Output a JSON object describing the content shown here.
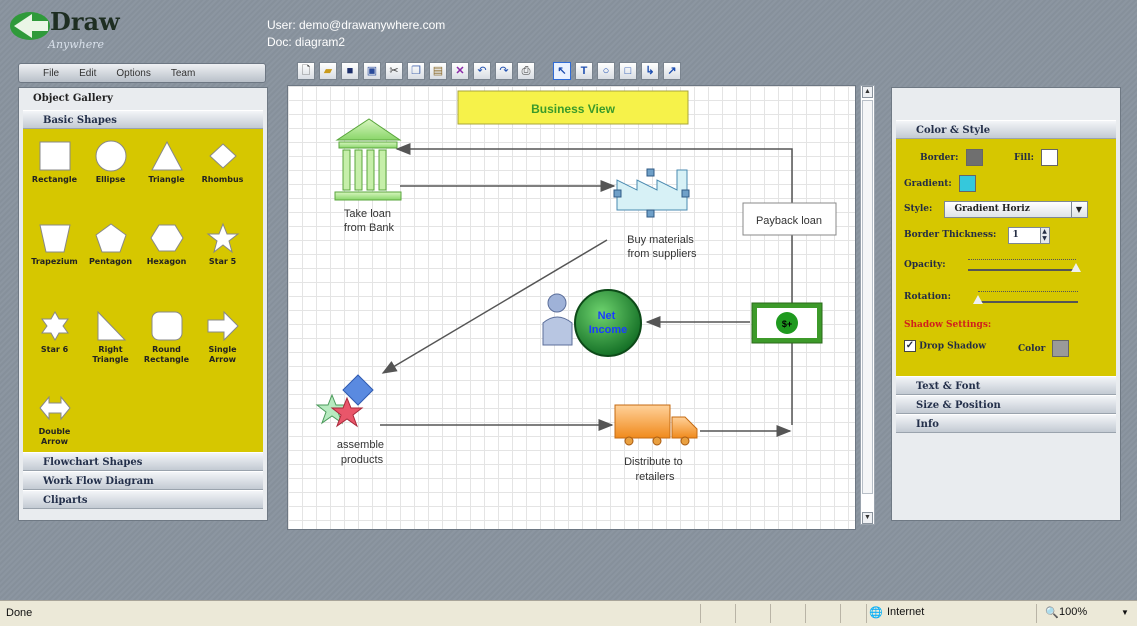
{
  "app": {
    "logo_text": "Draw",
    "logo_subtext": "Anywhere",
    "user_line": "User: demo@drawanywhere.com",
    "doc_line": "Doc: diagram2"
  },
  "menu": [
    "File",
    "Edit",
    "Options",
    "Team"
  ],
  "toolbar": {
    "buttons": [
      "new-document",
      "open-folder",
      "save",
      "save-as",
      "cut",
      "copy",
      "paste",
      "delete",
      "undo",
      "redo",
      "print"
    ],
    "tools": [
      {
        "name": "pointer",
        "glyph": "↖",
        "selected": true
      },
      {
        "name": "text",
        "glyph": "T",
        "selected": false
      },
      {
        "name": "ellipse",
        "glyph": "○",
        "selected": false
      },
      {
        "name": "rectangle",
        "glyph": "□",
        "selected": false
      },
      {
        "name": "connector",
        "glyph": "┖",
        "selected": false
      },
      {
        "name": "line",
        "glyph": "↗",
        "selected": false
      }
    ]
  },
  "left_panel": {
    "title": "Object Gallery",
    "sections": [
      "Basic Shapes",
      "Flowchart Shapes",
      "Work Flow Diagram",
      "Cliparts"
    ],
    "shapes": [
      "Rectangle",
      "Ellipse",
      "Triangle",
      "Rhombus",
      "Trapezium",
      "Pentagon",
      "Hexagon",
      "Star 5",
      "Star 6",
      "Right Triangle",
      "Round Rectangle",
      "Single Arrow",
      "Double Arrow"
    ],
    "accent_color": "#d6c700"
  },
  "canvas": {
    "title": "Business View",
    "nodes": {
      "bank": "Take loan from Bank",
      "factory": "Buy materials from suppliers",
      "payback": "Payback loan",
      "net_income": "Net Income",
      "money": "$+",
      "assemble": "assemble products",
      "distribute": "Distribute to retailers"
    },
    "bank_lines": [
      "Take loan",
      "from Bank"
    ],
    "factory_lines": [
      "Buy materials",
      "from suppliers"
    ],
    "net_lines": [
      "Net",
      "Income"
    ],
    "assemble_lines": [
      "assemble",
      "products"
    ],
    "distribute_lines": [
      "Distribute to",
      "retailers"
    ]
  },
  "right_panel": {
    "sections": [
      "Color & Style",
      "Text & Font",
      "Size & Position",
      "Info"
    ],
    "border_label": "Border:",
    "border_color": "#6f6f6f",
    "fill_label": "Fill:",
    "fill_color": "#ffffff",
    "gradient_label": "Gradient:",
    "gradient_color": "#35c8dc",
    "style_label": "Style:",
    "style_value": "Gradient Horiz",
    "border_thickness_label": "Border Thickness:",
    "border_thickness_value": "1",
    "opacity_label": "Opacity:",
    "opacity_value": 1.0,
    "rotation_label": "Rotation:",
    "rotation_value": 0,
    "shadow_settings_label": "Shadow Settings:",
    "drop_shadow_label": "Drop Shadow",
    "drop_shadow_checked": true,
    "color_label": "Color",
    "shadow_color": "#9a9a9a"
  },
  "statusbar": {
    "status": "Done",
    "zone": "Internet",
    "zoom": "100%"
  }
}
